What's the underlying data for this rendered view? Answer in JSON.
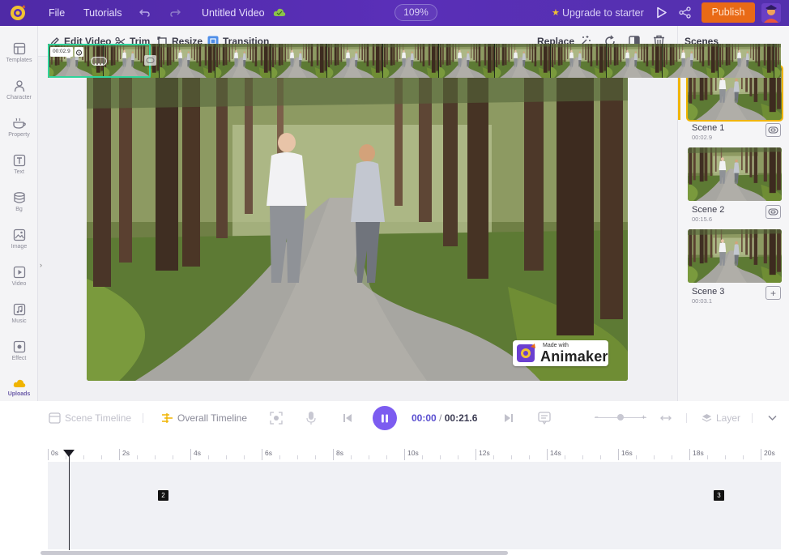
{
  "topbar": {
    "file": "File",
    "tutorials": "Tutorials",
    "title": "Untitled Video",
    "zoom": "109%",
    "upgrade": "Upgrade to starter",
    "publish": "Publish"
  },
  "rail": {
    "items": [
      {
        "label": "Templates"
      },
      {
        "label": "Character"
      },
      {
        "label": "Property"
      },
      {
        "label": "Text"
      },
      {
        "label": "Bg"
      },
      {
        "label": "Image"
      },
      {
        "label": "Video"
      },
      {
        "label": "Music"
      },
      {
        "label": "Effect"
      },
      {
        "label": "Uploads"
      }
    ]
  },
  "toolbar": {
    "edit_video": "Edit Video",
    "trim": "Trim",
    "resize": "Resize",
    "transition": "Transition",
    "replace": "Replace"
  },
  "watermark": {
    "made_with": "Made with",
    "brand": "Animaker"
  },
  "scenes": {
    "header": "Scenes",
    "list": [
      {
        "name": "Scene 1",
        "duration": "00:02.9"
      },
      {
        "name": "Scene 2",
        "duration": "00:15.6"
      },
      {
        "name": "Scene 3",
        "duration": "00:03.1"
      }
    ]
  },
  "timeline": {
    "scene_timeline": "Scene Timeline",
    "overall_timeline": "Overall Timeline",
    "current_time": "00:00",
    "separator": "/",
    "total_time": "00:21.6",
    "layer": "Layer",
    "ruler": [
      "0s",
      "2s",
      "4s",
      "6s",
      "8s",
      "10s",
      "12s",
      "14s",
      "16s",
      "18s",
      "20s"
    ],
    "clip_time": "00:02.9",
    "scene_markers": [
      "2",
      "3"
    ]
  },
  "colors": {
    "topbar": "#5a2fb8",
    "publish": "#e96a16",
    "accent_purple": "#7c5cf0",
    "scene_active": "#f0b400",
    "clip_active": "#2fd49a"
  }
}
